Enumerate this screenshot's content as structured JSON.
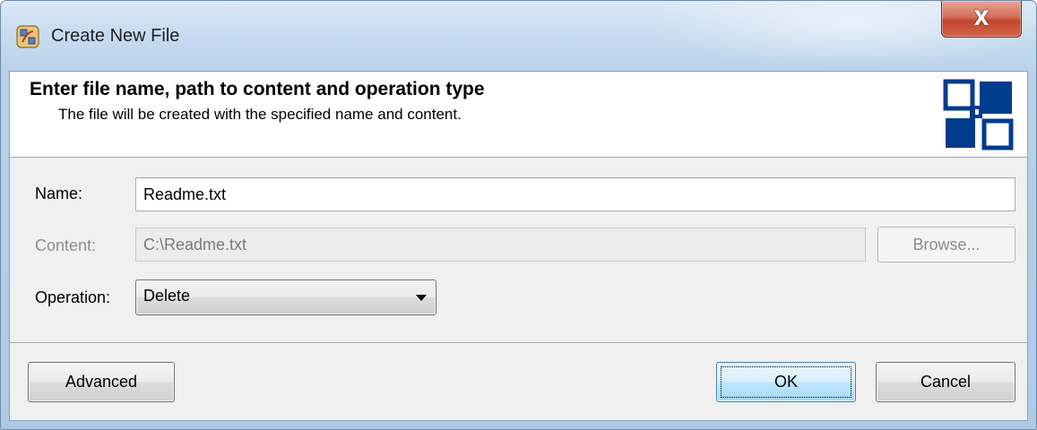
{
  "window": {
    "title": "Create New File",
    "close_symbol": "X",
    "icon": "app-tray-icon"
  },
  "header": {
    "title": "Enter file name, path to content and operation type",
    "subtitle": "The file will be created with the specified name and content.",
    "logo_icon": "squares-logo-icon"
  },
  "form": {
    "name": {
      "label": "Name:",
      "value": "Readme.txt"
    },
    "content": {
      "label": "Content:",
      "value": "C:\\Readme.txt",
      "browse_label": "Browse..."
    },
    "operation": {
      "label": "Operation:",
      "selected": "Delete"
    }
  },
  "footer": {
    "advanced_label": "Advanced",
    "ok_label": "OK",
    "cancel_label": "Cancel"
  },
  "colors": {
    "logo_blue": "#003c8c",
    "close_red": "#c2462e"
  }
}
